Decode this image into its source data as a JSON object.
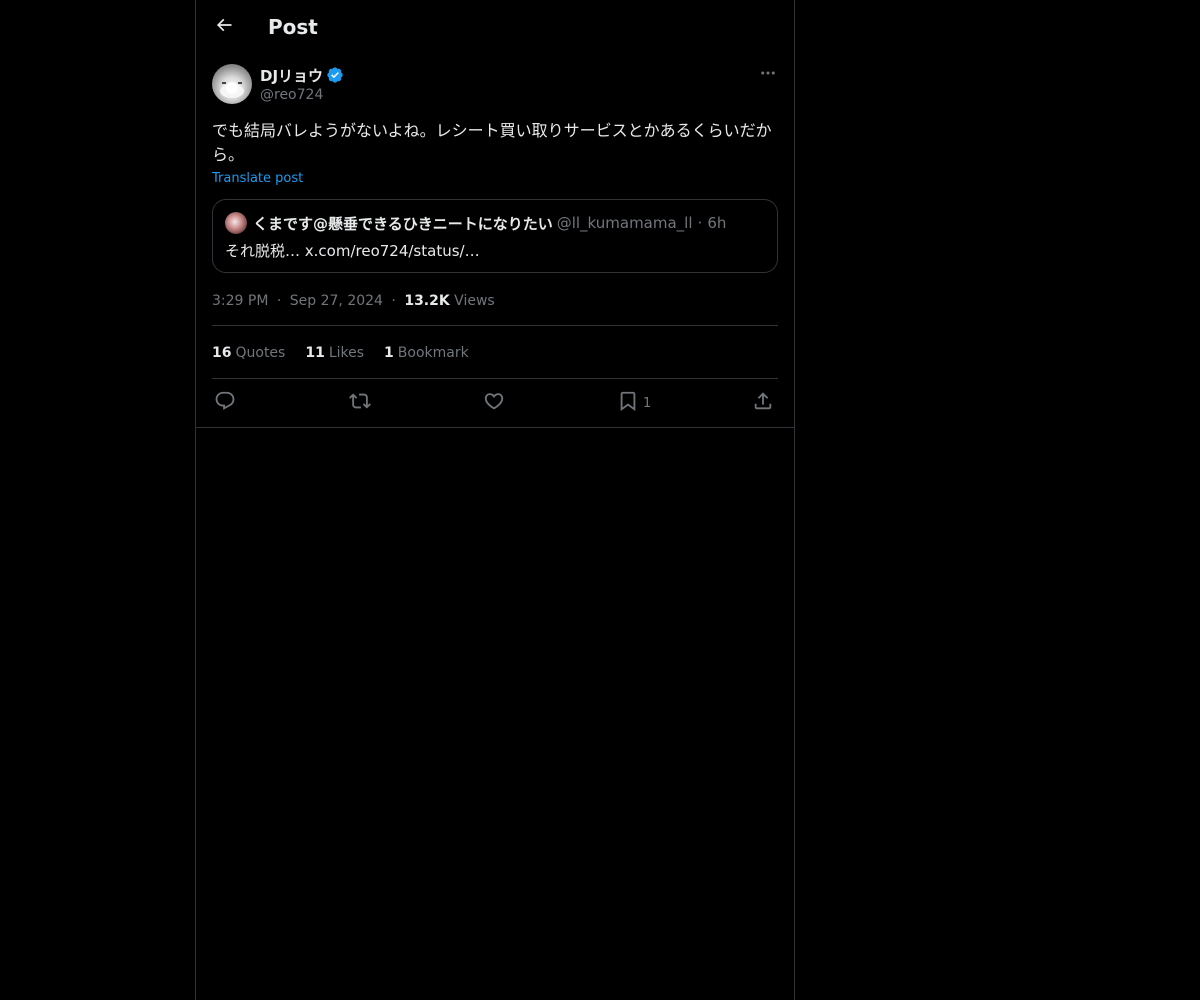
{
  "header": {
    "title": "Post",
    "back_icon": "arrow-left-icon"
  },
  "post": {
    "author": {
      "display_name": "DJリョウ",
      "handle": "@reo724",
      "verified": true,
      "verified_color": "#1d9bf0"
    },
    "text": "でも結局バレようがないよね。レシート買い取りサービスとかあるくらいだから。",
    "translate_label": "Translate post",
    "quote": {
      "display_name": "くまです@懸垂できるひきニートになりたい",
      "handle": "@ll_kumamama_ll",
      "separator": "·",
      "time": "6h",
      "body": "それ脱税… x.com/reo724/status/…"
    },
    "meta": {
      "time": "3:29 PM",
      "separator": "·",
      "date": "Sep 27, 2024",
      "views_count": "13.2K",
      "views_label": "Views"
    },
    "stats": [
      {
        "count": "16",
        "label": "Quotes"
      },
      {
        "count": "11",
        "label": "Likes"
      },
      {
        "count": "1",
        "label": "Bookmark"
      }
    ],
    "actions": {
      "reply_icon": "reply-icon",
      "repost_icon": "repost-icon",
      "like_icon": "heart-icon",
      "bookmark_icon": "bookmark-icon",
      "bookmark_count": "1",
      "share_icon": "share-icon"
    }
  },
  "colors": {
    "background": "#000000",
    "border": "#2f3336",
    "text_primary": "#e7e9ea",
    "text_secondary": "#71767b",
    "accent": "#1d9bf0"
  }
}
